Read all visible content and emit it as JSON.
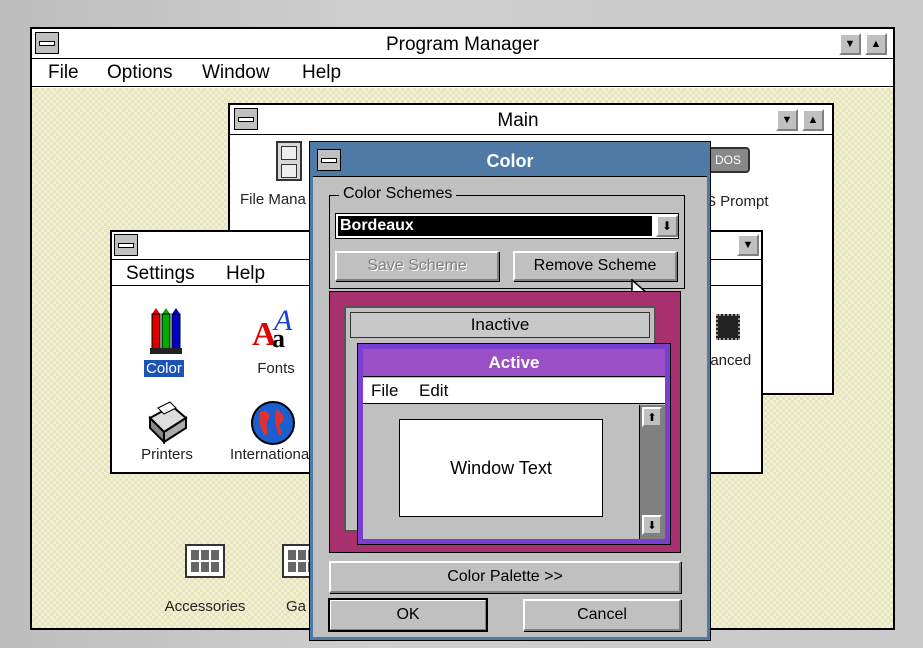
{
  "program_manager": {
    "title": "Program Manager",
    "menu": [
      "File",
      "Options",
      "Window",
      "Help"
    ],
    "icons": [
      {
        "label": "Accessories",
        "icon": "group-icon"
      },
      {
        "label": "Ga",
        "icon": "group-icon"
      }
    ]
  },
  "main_window": {
    "title": "Main",
    "icons": [
      {
        "label": "File Mana",
        "icon": "file-manager-icon"
      },
      {
        "label": "S Prompt",
        "icon": "dos-prompt-icon",
        "badge": "DOS"
      }
    ]
  },
  "control_panel": {
    "menu": [
      "Settings",
      "Help"
    ],
    "icons": [
      {
        "label": "Color",
        "icon": "color-icon"
      },
      {
        "label": "Fonts",
        "icon": "fonts-icon"
      },
      {
        "label": "hanced",
        "icon": "chip-icon"
      },
      {
        "label": "Printers",
        "icon": "printers-icon"
      },
      {
        "label": "Internationa",
        "icon": "globe-icon"
      }
    ]
  },
  "color_dialog": {
    "title": "Color",
    "group_label": "Color Schemes",
    "scheme_value": "Bordeaux",
    "save_label": "Save Scheme",
    "remove_label": "Remove Scheme",
    "preview": {
      "inactive_title": "Inactive",
      "active_title": "Active",
      "menu_file": "File",
      "menu_edit": "Edit",
      "window_text": "Window Text"
    },
    "palette_label": "Color Palette >>",
    "ok_label": "OK",
    "cancel_label": "Cancel"
  },
  "colors": {
    "dialog_title_bar": "#4f7aa5",
    "preview_bg": "#a8306f",
    "active_border": "#7a3fd0",
    "active_title": "#9b4fc7",
    "inactive_title": "#c0c0c0"
  }
}
